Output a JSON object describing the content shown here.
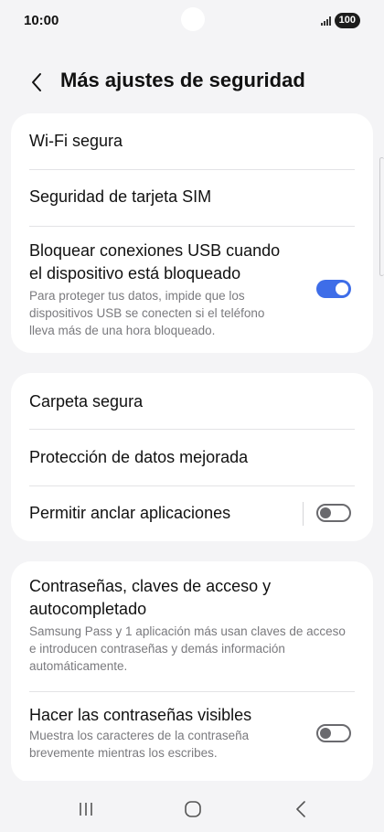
{
  "status": {
    "time": "10:00",
    "signal_icon": "signal-icon",
    "battery_level": "100"
  },
  "header": {
    "back_icon": "chevron-left-icon",
    "title": "Más ajustes de seguridad"
  },
  "cards": [
    {
      "items": [
        {
          "title": "Wi-Fi segura"
        },
        {
          "title": "Seguridad de tarjeta SIM"
        },
        {
          "title": "Bloquear conexiones USB cuando el dispositivo está bloqueado",
          "subtitle": "Para proteger tus datos, impide que los dispositivos USB se conecten si el teléfono lleva más de una hora bloqueado.",
          "toggle": true
        }
      ]
    },
    {
      "items": [
        {
          "title": "Carpeta segura"
        },
        {
          "title": "Protección de datos mejorada"
        },
        {
          "title": "Permitir anclar aplicaciones",
          "toggle": false
        }
      ]
    },
    {
      "items": [
        {
          "title": "Contraseñas, claves de acceso y autocompletado",
          "subtitle": "Samsung Pass y 1 aplicación más usan claves de acceso e introducen contraseñas y demás información automáticamente."
        },
        {
          "title": "Hacer las contraseñas visibles",
          "subtitle": "Muestra los caracteres de la contraseña brevemente mientras los escribes.",
          "toggle": false
        }
      ]
    }
  ],
  "colors": {
    "accent": "#3e6de8",
    "background": "#f4f4f6",
    "card": "#ffffff"
  },
  "navbar": {
    "recent_icon": "recent-apps-icon",
    "home_icon": "home-icon",
    "back_icon": "back-icon"
  }
}
